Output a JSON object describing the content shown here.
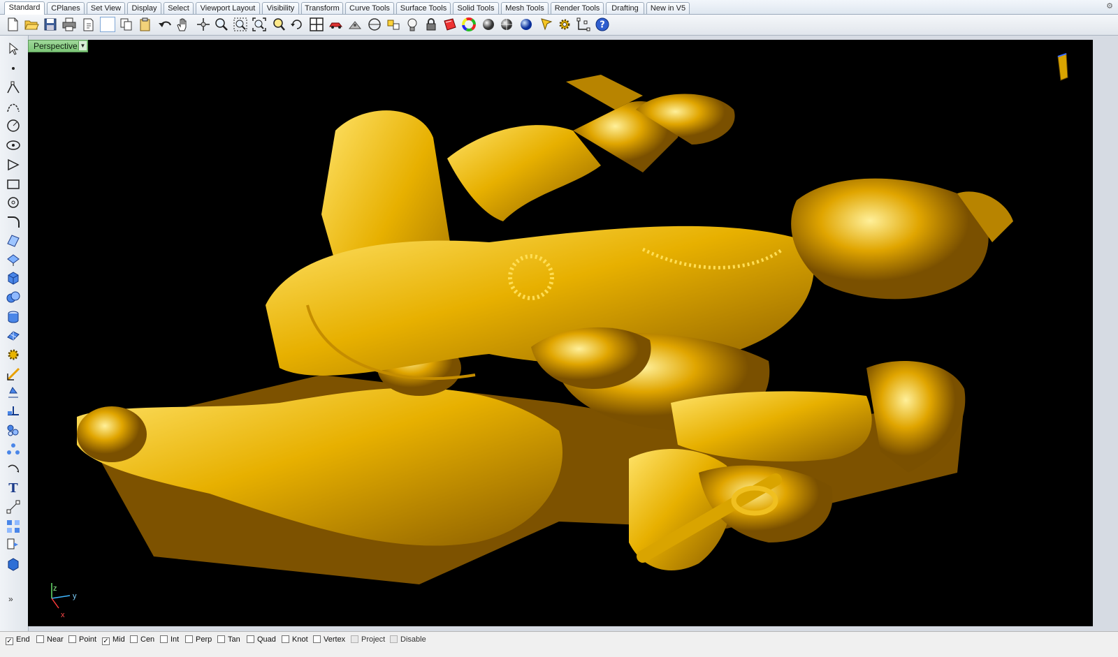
{
  "tabs": [
    {
      "label": "Standard",
      "active": true
    },
    {
      "label": "CPlanes"
    },
    {
      "label": "Set View"
    },
    {
      "label": "Display"
    },
    {
      "label": "Select"
    },
    {
      "label": "Viewport Layout"
    },
    {
      "label": "Visibility"
    },
    {
      "label": "Transform"
    },
    {
      "label": "Curve Tools"
    },
    {
      "label": "Surface Tools"
    },
    {
      "label": "Solid Tools"
    },
    {
      "label": "Mesh Tools"
    },
    {
      "label": "Render Tools"
    },
    {
      "label": "Drafting"
    },
    {
      "label": "New in V5"
    }
  ],
  "toolbar_icons": [
    "new-file-icon",
    "open-folder-icon",
    "save-icon",
    "print-icon",
    "import-icon",
    "blank-icon",
    "copy-icon",
    "paste-icon",
    "undo-icon",
    "pan-hand-icon",
    "rotate-view-icon",
    "zoom-dynamic-icon",
    "zoom-window-icon",
    "zoom-extents-icon",
    "zoom-selected-icon",
    "undo-view-icon",
    "four-viewports-icon",
    "car-icon",
    "gumball-icon",
    "cplane-icon",
    "named-view-icon",
    "light-bulb-icon",
    "lock-icon",
    "color-icon",
    "color-wheel-icon",
    "shade-icon",
    "render-preview-icon",
    "render-sphere-icon",
    "properties-icon",
    "options-gear-icon",
    "snap-points-icon",
    "help-icon"
  ],
  "left_icons": [
    "select-arrow-icon",
    "point-icon",
    "polyline-icon",
    "curve-icon",
    "circle-icon",
    "ellipse-icon",
    "polygon-icon",
    "rectangle-icon",
    "arc-icon",
    "fillet-icon",
    "surface-icon",
    "extrude-icon",
    "box-icon",
    "boolean-icon",
    "cylinder-icon",
    "mesh-icon",
    "explode-gear-icon",
    "move-arrow-icon",
    "transform-icon",
    "join-icon",
    "align-icon",
    "array-icon",
    "rotate-icon",
    "text-icon",
    "dimension-icon",
    "group-icon",
    "block-icon",
    "solid-box-icon"
  ],
  "viewport": {
    "label": "Perspective",
    "axes": {
      "x": "x",
      "y": "y",
      "z": "z"
    }
  },
  "colors": {
    "model_gold": "#d9a400",
    "viewport_bg": "#000000",
    "label_green": "#8fd08a"
  },
  "osnap": [
    {
      "label": "End",
      "checked": true
    },
    {
      "label": "Near",
      "checked": false
    },
    {
      "label": "Point",
      "checked": false
    },
    {
      "label": "Mid",
      "checked": true
    },
    {
      "label": "Cen",
      "checked": false
    },
    {
      "label": "Int",
      "checked": false
    },
    {
      "label": "Perp",
      "checked": false
    },
    {
      "label": "Tan",
      "checked": false
    },
    {
      "label": "Quad",
      "checked": false
    },
    {
      "label": "Knot",
      "checked": false
    },
    {
      "label": "Vertex",
      "checked": false
    },
    {
      "label": "Project",
      "checked": false,
      "disabled": true
    },
    {
      "label": "Disable",
      "checked": false,
      "disabled": true
    }
  ]
}
